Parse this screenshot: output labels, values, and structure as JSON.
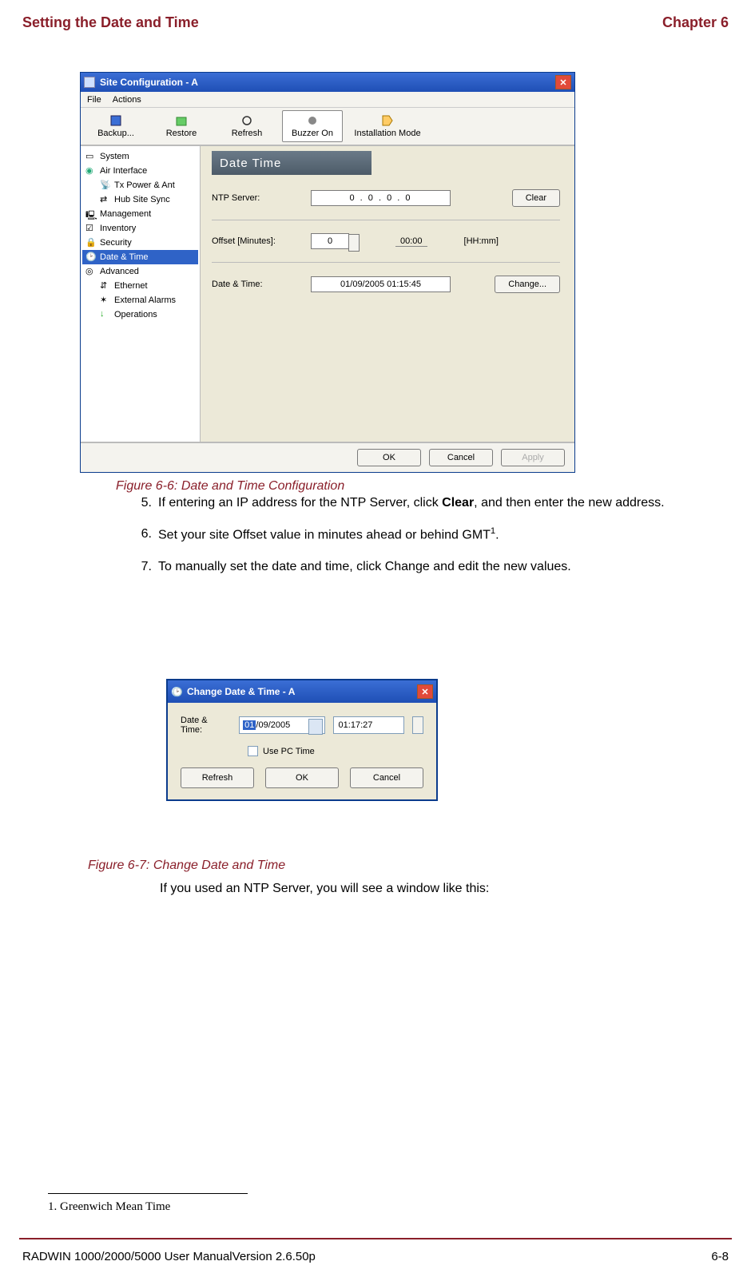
{
  "header": {
    "left": "Setting the Date and Time",
    "right": "Chapter 6"
  },
  "fig1": {
    "title": "Site Configuration - A",
    "menus": [
      "File",
      "Actions"
    ],
    "toolbar": [
      "Backup...",
      "Restore",
      "Refresh",
      "Buzzer On",
      "Installation Mode"
    ],
    "tree": [
      {
        "label": "System"
      },
      {
        "label": "Air Interface"
      },
      {
        "label": "Tx Power & Ant",
        "child": true
      },
      {
        "label": "Hub Site Sync",
        "child": true
      },
      {
        "label": "Management"
      },
      {
        "label": "Inventory"
      },
      {
        "label": "Security"
      },
      {
        "label": "Date & Time",
        "selected": true
      },
      {
        "label": "Advanced"
      },
      {
        "label": "Ethernet",
        "child": true
      },
      {
        "label": "External Alarms",
        "child": true
      },
      {
        "label": "Operations",
        "child": true
      }
    ],
    "section": "Date  Time",
    "ntp_label": "NTP Server:",
    "ntp_value": "0  .  0  .  0  .  0",
    "clear": "Clear",
    "offset_label": "Offset [Minutes]:",
    "offset_value": "0",
    "offset_ro": "00:00",
    "offset_unit": "[HH:mm]",
    "dt_label": "Date & Time:",
    "dt_value": "01/09/2005 01:15:45",
    "change": "Change...",
    "ok": "OK",
    "cancel": "Cancel",
    "apply": "Apply",
    "caption": "Figure 6-6: Date and Time Configuration"
  },
  "steps": {
    "s5a": "If entering an IP address for the NTP Server, click ",
    "s5b": "Clear",
    "s5c": ", and then enter the new address.",
    "s6a": "Set your site Offset value in minutes ahead or behind GMT",
    "s6sup": "1",
    "s6b": ".",
    "s7": "To manually set the date and time, click Change and edit the new values."
  },
  "fig2": {
    "title": "Change Date & Time - A",
    "dt_label": "Date & Time:",
    "date_sel": "01",
    "date_rest": "/09/2005",
    "time": "01:17:27",
    "use_pc": "Use PC Time",
    "refresh": "Refresh",
    "ok": "OK",
    "cancel": "Cancel",
    "caption": "Figure 6-7: Change Date and Time"
  },
  "posttext": "If you used an NTP Server, you will see a window like this:",
  "footnote": "1.  Greenwich Mean Time",
  "footer": {
    "left": "RADWIN 1000/2000/5000 User ManualVersion  2.6.50p",
    "right": "6-8"
  },
  "colors": {
    "accent": "#8a1f2a",
    "xp_blue": "#2f63c7"
  }
}
